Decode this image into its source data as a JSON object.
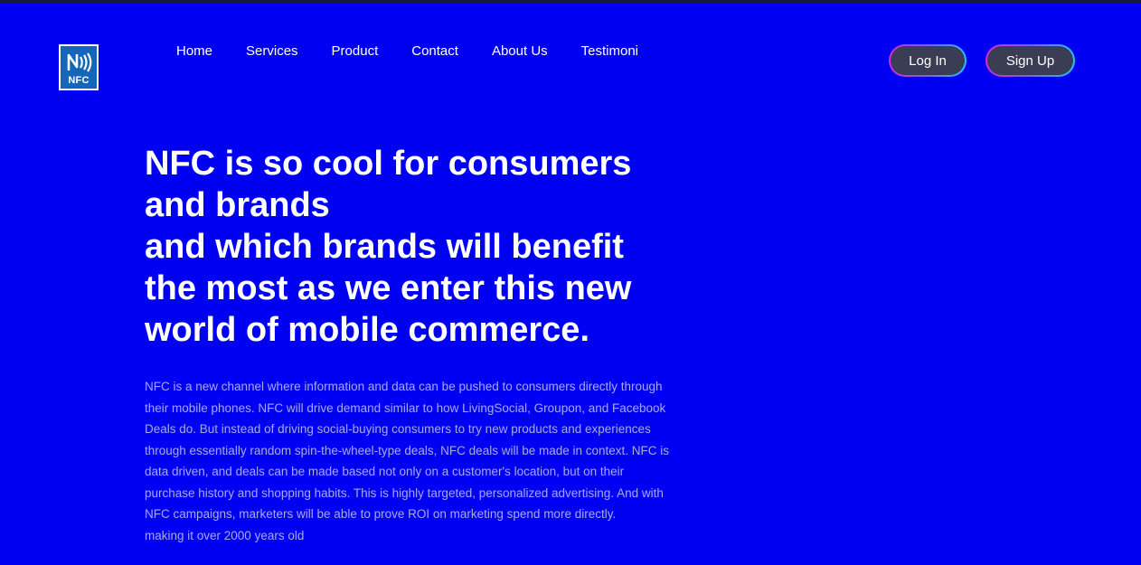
{
  "header": {
    "logo": {
      "text": "NFC",
      "icon": "nfc-icon"
    },
    "nav": [
      {
        "label": "Home"
      },
      {
        "label": "Services"
      },
      {
        "label": "Product"
      },
      {
        "label": "Contact"
      },
      {
        "label": "About Us"
      },
      {
        "label": "Testimoni"
      }
    ],
    "login_label": "Log In",
    "signup_label": "Sign Up"
  },
  "hero": {
    "title_lines": [
      "NFC is so cool for consumers",
      "and brands",
      "and which brands will benefit",
      "the most as we enter this new",
      "world of mobile commerce."
    ],
    "body_lines": [
      "NFC is a new channel where information and data can be pushed to consumers directly through",
      "their mobile phones. NFC will drive demand similar to how LivingSocial, Groupon, and Facebook",
      "Deals do. But instead of driving social-buying consumers to try new products and experiences",
      "through essentially random spin-the-wheel-type deals, NFC deals will be made in context. NFC is",
      "data driven, and deals can be made based not only on a customer's location, but on their",
      "purchase history and shopping habits. This is highly targeted, personalized advertising. And with",
      "NFC campaigns, marketers will be able to prove ROI on marketing spend more directly.",
      "making it over 2000 years old"
    ]
  },
  "colors": {
    "background": "#0000f2",
    "button_bg": "#3b3d55",
    "body_text": "#a9a9ee"
  }
}
